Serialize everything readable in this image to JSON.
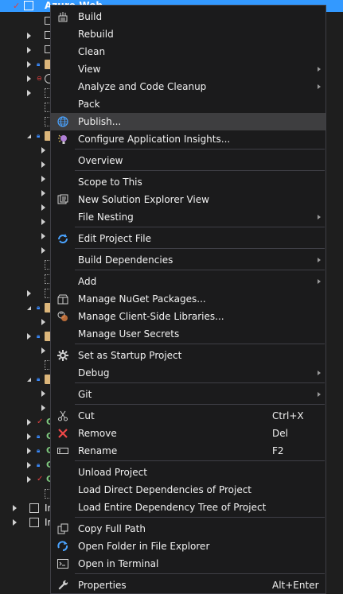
{
  "explorer": {
    "header_label": "Azure.Web",
    "bottom_items": [
      {
        "label": "In"
      },
      {
        "label": "In"
      }
    ]
  },
  "menu": {
    "items": [
      {
        "id": "build",
        "label": "Build",
        "shortcut": "",
        "submenu": false,
        "icon": "build-icon"
      },
      {
        "id": "rebuild",
        "label": "Rebuild",
        "shortcut": "",
        "submenu": false,
        "icon": ""
      },
      {
        "id": "clean",
        "label": "Clean",
        "shortcut": "",
        "submenu": false,
        "icon": ""
      },
      {
        "id": "view",
        "label": "View",
        "shortcut": "",
        "submenu": true,
        "icon": ""
      },
      {
        "id": "analyze",
        "label": "Analyze and Code Cleanup",
        "shortcut": "",
        "submenu": true,
        "icon": ""
      },
      {
        "id": "pack",
        "label": "Pack",
        "shortcut": "",
        "submenu": false,
        "icon": ""
      },
      {
        "id": "publish",
        "label": "Publish...",
        "shortcut": "",
        "submenu": false,
        "icon": "globe-icon",
        "highlight": true
      },
      {
        "id": "insights",
        "label": "Configure Application Insights...",
        "shortcut": "",
        "submenu": false,
        "icon": "insights-icon"
      },
      {
        "id": "overview",
        "label": "Overview",
        "shortcut": "",
        "submenu": false,
        "icon": ""
      },
      {
        "id": "scope",
        "label": "Scope to This",
        "shortcut": "",
        "submenu": false,
        "icon": ""
      },
      {
        "id": "newview",
        "label": "New Solution Explorer View",
        "shortcut": "",
        "submenu": false,
        "icon": "new-view-icon"
      },
      {
        "id": "nesting",
        "label": "File Nesting",
        "shortcut": "",
        "submenu": true,
        "icon": ""
      },
      {
        "id": "editproj",
        "label": "Edit Project File",
        "shortcut": "",
        "submenu": false,
        "icon": "edit-project-icon"
      },
      {
        "id": "builddeps",
        "label": "Build Dependencies",
        "shortcut": "",
        "submenu": true,
        "icon": ""
      },
      {
        "id": "add",
        "label": "Add",
        "shortcut": "",
        "submenu": true,
        "icon": ""
      },
      {
        "id": "nuget",
        "label": "Manage NuGet Packages...",
        "shortcut": "",
        "submenu": false,
        "icon": "nuget-icon"
      },
      {
        "id": "clientlibs",
        "label": "Manage Client-Side Libraries...",
        "shortcut": "",
        "submenu": false,
        "icon": "client-libs-icon"
      },
      {
        "id": "secrets",
        "label": "Manage User Secrets",
        "shortcut": "",
        "submenu": false,
        "icon": ""
      },
      {
        "id": "startup",
        "label": "Set as Startup Project",
        "shortcut": "",
        "submenu": false,
        "icon": "gear-icon"
      },
      {
        "id": "debug",
        "label": "Debug",
        "shortcut": "",
        "submenu": true,
        "icon": ""
      },
      {
        "id": "git",
        "label": "Git",
        "shortcut": "",
        "submenu": true,
        "icon": ""
      },
      {
        "id": "cut",
        "label": "Cut",
        "shortcut": "Ctrl+X",
        "submenu": false,
        "icon": "scissors-icon"
      },
      {
        "id": "remove",
        "label": "Remove",
        "shortcut": "Del",
        "submenu": false,
        "icon": "remove-x-icon"
      },
      {
        "id": "rename",
        "label": "Rename",
        "shortcut": "F2",
        "submenu": false,
        "icon": "rename-icon"
      },
      {
        "id": "unload",
        "label": "Unload Project",
        "shortcut": "",
        "submenu": false,
        "icon": ""
      },
      {
        "id": "loaddirect",
        "label": "Load Direct Dependencies of Project",
        "shortcut": "",
        "submenu": false,
        "icon": ""
      },
      {
        "id": "loadtree",
        "label": "Load Entire Dependency Tree of Project",
        "shortcut": "",
        "submenu": false,
        "icon": ""
      },
      {
        "id": "copypath",
        "label": "Copy Full Path",
        "shortcut": "",
        "submenu": false,
        "icon": "copy-icon"
      },
      {
        "id": "openfolder",
        "label": "Open Folder in File Explorer",
        "shortcut": "",
        "submenu": false,
        "icon": "refresh-arrow-icon"
      },
      {
        "id": "terminal",
        "label": "Open in Terminal",
        "shortcut": "",
        "submenu": false,
        "icon": "terminal-icon"
      },
      {
        "id": "properties",
        "label": "Properties",
        "shortcut": "Alt+Enter",
        "submenu": false,
        "icon": "wrench-icon"
      }
    ]
  },
  "colors": {
    "menu_bg": "#1b1b1c",
    "menu_border": "#3f3f46",
    "highlight": "#3e3e40",
    "selection": "#3399ff",
    "text": "#f1f1f1"
  }
}
